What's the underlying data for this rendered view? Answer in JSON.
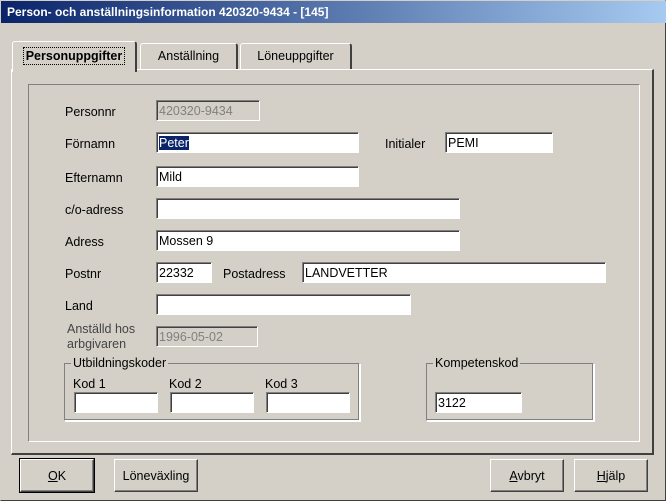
{
  "window": {
    "title": "Person- och anställningsinformation  420320-9434 - [145]"
  },
  "tabs": [
    {
      "label": "Personuppgifter",
      "active": true
    },
    {
      "label": "Anställning",
      "active": false
    },
    {
      "label": "Löneuppgifter",
      "active": false
    }
  ],
  "form": {
    "personnr": {
      "label": "Personnr",
      "value": "420320-9434"
    },
    "fornamn": {
      "label": "Förnamn",
      "value": "Peter"
    },
    "initialer": {
      "label": "Initialer",
      "value": "PEMI"
    },
    "efternamn": {
      "label": "Efternamn",
      "value": "Mild"
    },
    "co_adress": {
      "label": "c/o-adress",
      "value": ""
    },
    "adress": {
      "label": "Adress",
      "value": "Mossen 9"
    },
    "postnr": {
      "label": "Postnr",
      "value": "22332"
    },
    "postadress": {
      "label": "Postadress",
      "value": "LANDVETTER"
    },
    "land": {
      "label": "Land",
      "value": ""
    },
    "anstalld": {
      "label_line1": "Anställd hos",
      "label_line2": "arbgivaren",
      "value": "1996-05-02"
    },
    "utbildning": {
      "legend": "Utbildningskoder",
      "kod1": {
        "label": "Kod 1",
        "value": ""
      },
      "kod2": {
        "label": "Kod 2",
        "value": ""
      },
      "kod3": {
        "label": "Kod 3",
        "value": ""
      }
    },
    "kompetens": {
      "legend": "Kompetenskod",
      "value": "3122"
    }
  },
  "buttons": {
    "ok": {
      "label_ul": "O",
      "label_rest": "K"
    },
    "lonevaxling": {
      "label": "Löneväxling"
    },
    "avbryt": {
      "label_ul": "A",
      "label_rest": "vbryt"
    },
    "hjalp": {
      "label_ul": "H",
      "label_rest": "jälp"
    }
  },
  "colors": {
    "title_start": "#0a246a",
    "title_end": "#a6caf0",
    "face": "#d4d0c8",
    "selection": "#0a246a"
  }
}
